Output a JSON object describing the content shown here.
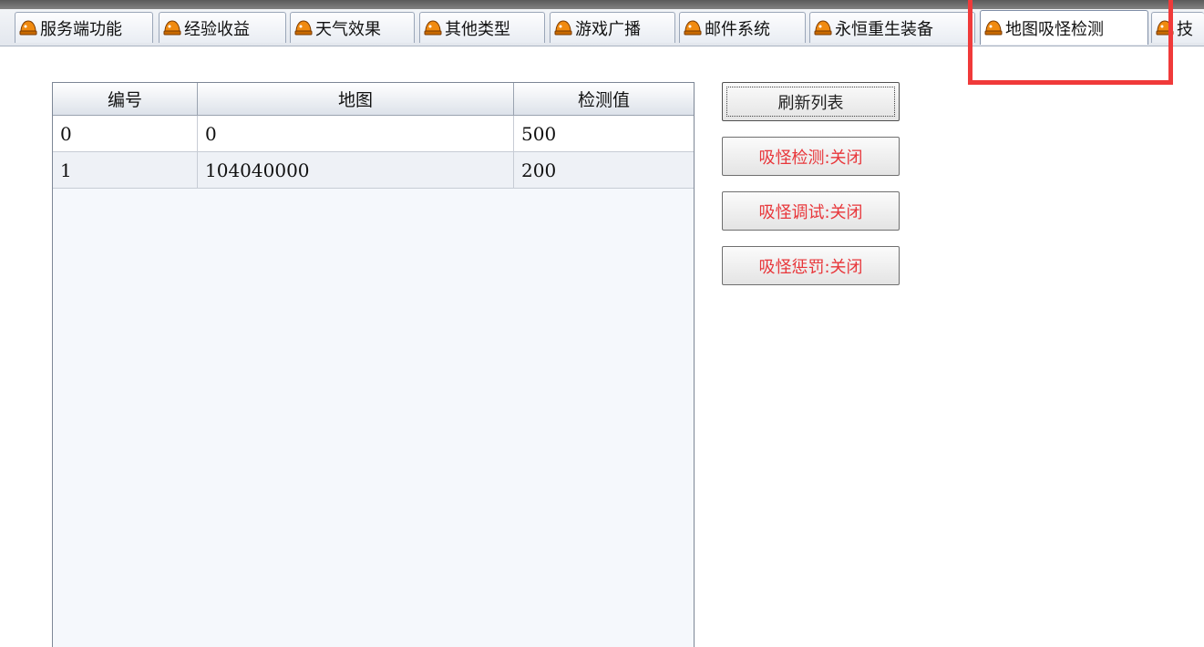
{
  "tabs": [
    {
      "label": "服务端功能"
    },
    {
      "label": "经验收益"
    },
    {
      "label": "天气效果"
    },
    {
      "label": "其他类型"
    },
    {
      "label": "游戏广播"
    },
    {
      "label": "邮件系统"
    },
    {
      "label": "永恒重生装备"
    },
    {
      "label": "地图吸怪检测",
      "active": true
    },
    {
      "label": "技"
    }
  ],
  "table": {
    "columns": [
      "编号",
      "地图",
      "检测值"
    ],
    "rows": [
      [
        "0",
        "0",
        "500"
      ],
      [
        "1",
        "104040000",
        "200"
      ]
    ]
  },
  "buttons": {
    "refresh": "刷新列表",
    "detect": "吸怪检测:关闭",
    "debug": "吸怪调试:关闭",
    "punish": "吸怪惩罚:关闭"
  },
  "colors": {
    "button_text_red": "#e8363a",
    "highlight_red": "#f03a3a",
    "tab_icon_orange": "#f08a10"
  },
  "icons": {
    "tab_icon": "orange-helmet-icon"
  }
}
